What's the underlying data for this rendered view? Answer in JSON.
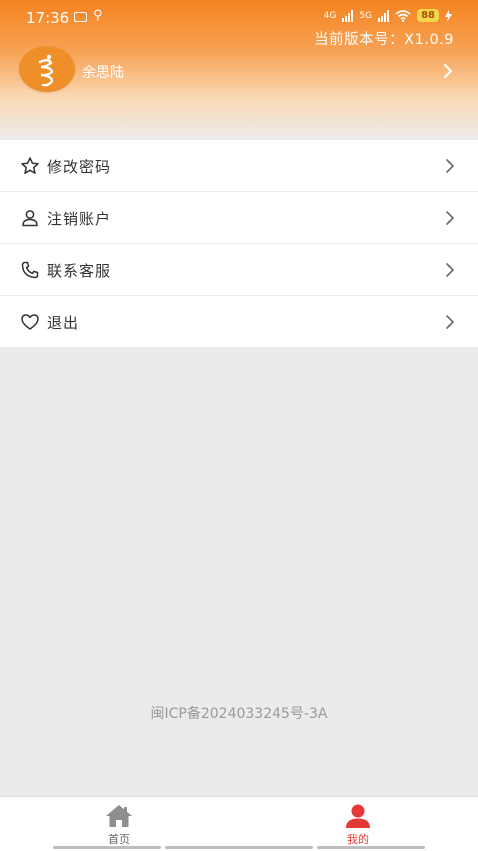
{
  "status_bar": {
    "time": "17:36",
    "network_1": "4G",
    "network_2": "5G",
    "battery": "88"
  },
  "header": {
    "version_text": "当前版本号：X1.0.9",
    "user_name": "余思陆",
    "colors": {
      "gradient_top": "#f5821f",
      "gradient_mid": "#f7a457",
      "avatar_bg": "#ef8f2a"
    }
  },
  "menu": {
    "items": [
      {
        "label": "修改密码",
        "icon": "star-icon"
      },
      {
        "label": "注销账户",
        "icon": "user-icon"
      },
      {
        "label": "联系客服",
        "icon": "phone-icon"
      },
      {
        "label": "退出",
        "icon": "heart-icon"
      }
    ]
  },
  "footer": {
    "icp": "闽ICP备2024033245号-3A"
  },
  "tabbar": {
    "tabs": [
      {
        "label": "首页",
        "icon": "home-icon",
        "active": false
      },
      {
        "label": "我的",
        "icon": "person-icon",
        "active": true
      }
    ],
    "active_color": "#e53935"
  }
}
